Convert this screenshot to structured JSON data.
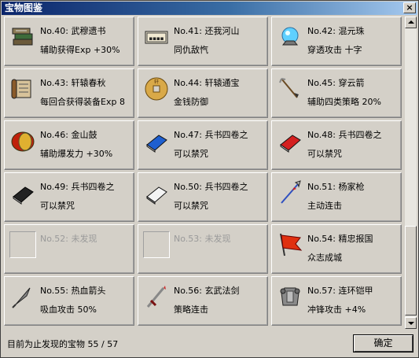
{
  "window": {
    "title": "宝物图鉴",
    "close_glyph": "×"
  },
  "items": [
    {
      "no": "No.40:",
      "name": "武穆遗书",
      "desc": "辅助获得Exp +30%",
      "icon": "book-stack-icon",
      "locked": false
    },
    {
      "no": "No.41:",
      "name": "还我河山",
      "desc": "同仇敌忾",
      "icon": "plaque-icon",
      "locked": false
    },
    {
      "no": "No.42:",
      "name": "混元珠",
      "desc": "穿透攻击 十字",
      "icon": "orb-icon",
      "locked": false
    },
    {
      "no": "No.43:",
      "name": "轩辕春秋",
      "desc": "每回合获得装备Exp 8",
      "icon": "scroll-icon",
      "locked": false
    },
    {
      "no": "No.44:",
      "name": "轩辕通宝",
      "desc": "金钱防御",
      "icon": "coin-icon",
      "locked": false
    },
    {
      "no": "No.45:",
      "name": "穿云箭",
      "desc": "辅助四类策略 20%",
      "icon": "arrow-icon",
      "locked": false
    },
    {
      "no": "No.46:",
      "name": "金山鼓",
      "desc": "辅助爆发力 +30%",
      "icon": "drum-icon",
      "locked": false
    },
    {
      "no": "No.47:",
      "name": "兵书四卷之",
      "desc": "可以禁咒",
      "icon": "blue-book-icon",
      "locked": false
    },
    {
      "no": "No.48:",
      "name": "兵书四卷之",
      "desc": "可以禁咒",
      "icon": "red-book-icon",
      "locked": false
    },
    {
      "no": "No.49:",
      "name": "兵书四卷之",
      "desc": "可以禁咒",
      "icon": "black-book-icon",
      "locked": false
    },
    {
      "no": "No.50:",
      "name": "兵书四卷之",
      "desc": "可以禁咒",
      "icon": "white-book-icon",
      "locked": false
    },
    {
      "no": "No.51:",
      "name": "杨家枪",
      "desc": "主动连击",
      "icon": "spear-icon",
      "locked": false
    },
    {
      "no": "No.52:",
      "name": "未发现",
      "desc": "",
      "icon": "empty-slot-icon",
      "locked": true
    },
    {
      "no": "No.53:",
      "name": "未发现",
      "desc": "",
      "icon": "empty-slot-icon",
      "locked": true
    },
    {
      "no": "No.54:",
      "name": "精忠报国",
      "desc": "众志成城",
      "icon": "banner-icon",
      "locked": false
    },
    {
      "no": "No.55:",
      "name": "热血箭头",
      "desc": "吸血攻击 50%",
      "icon": "arrowhead-icon",
      "locked": false
    },
    {
      "no": "No.56:",
      "name": "玄武法剑",
      "desc": "策略连击",
      "icon": "sword-icon",
      "locked": false
    },
    {
      "no": "No.57:",
      "name": "连环铠甲",
      "desc": "冲锋攻击 +4%",
      "icon": "armor-icon",
      "locked": false
    }
  ],
  "footer": {
    "status_text": "目前为止发现的宝物 55 / 57",
    "ok_label": "确定"
  }
}
